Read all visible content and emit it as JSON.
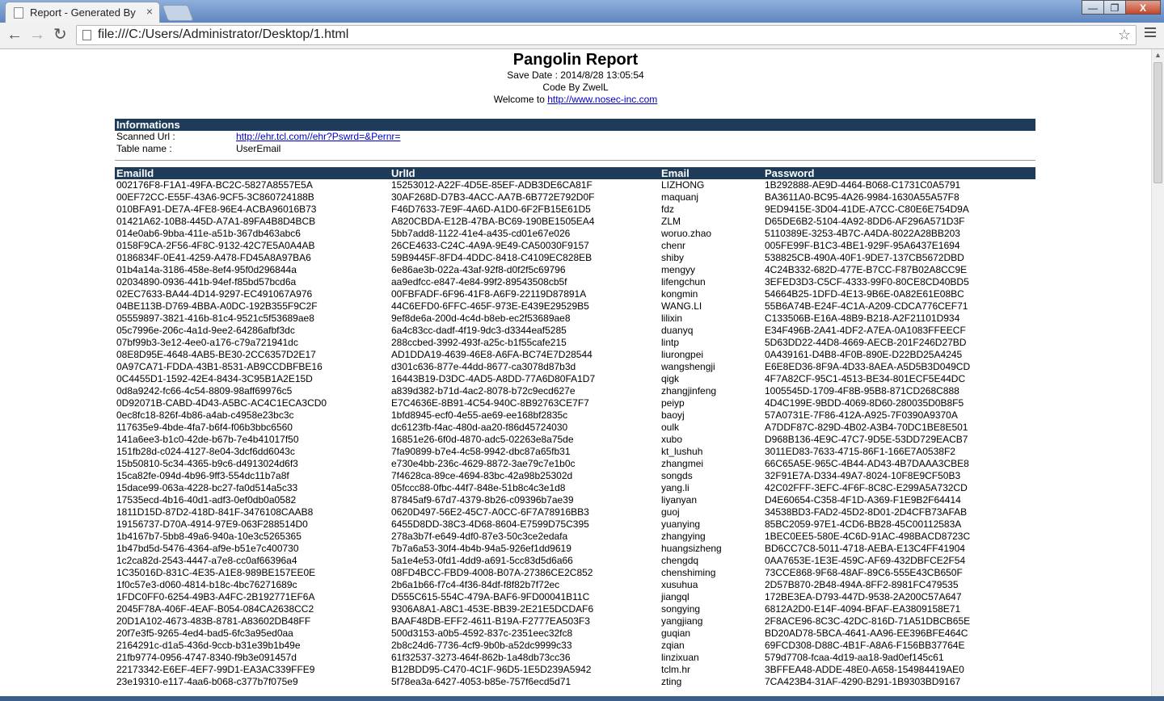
{
  "browser": {
    "tab_title": "Report - Generated By",
    "tab_close": "×",
    "url": "file:///C:/Users/Administrator/Desktop/1.html",
    "back": "←",
    "forward": "→",
    "reload": "↻",
    "star": "☆",
    "min": "—",
    "max": "❐",
    "close": "X"
  },
  "report": {
    "title": "Pangolin Report",
    "save_date": "Save Date : 2014/8/28 13:05:54",
    "code_by": "Code By ZwelL",
    "welcome_prefix": "Welcome to ",
    "welcome_link": "http://www.nosec-inc.com"
  },
  "informations": {
    "heading": "Informations",
    "scanned_url_label": "Scanned Url :",
    "scanned_url_value": "http://ehr.tcl.com//ehr?Pswrd=&Pernr=",
    "table_name_label": "Table name :",
    "table_name_value": "UserEmail"
  },
  "table": {
    "columns": [
      "EmailId",
      "UrlId",
      "Email",
      "Password"
    ],
    "rows": [
      [
        "002176F8-F1A1-49FA-BC2C-5827A8557E5A",
        "15253012-A22F-4D5E-85EF-ADB3DE6CA81F",
        "LIZHONG",
        "1B292888-AE9D-4464-B068-C1731C0A5791"
      ],
      [
        "00EF72CC-E55F-43A6-9CF5-3C860724188B",
        "30AF268D-D7B3-4ACC-AA7B-6B772E792D0F",
        "maquanj",
        "BA3611A0-BC95-4A26-9984-1630A55A57F8"
      ],
      [
        "010BFA91-DE7A-4FE8-96E4-ACBA96016B73",
        "F46D7633-7E9F-4A6D-A1D0-6F2FB15E61D5",
        "fdz",
        "9ED9415E-3D04-41DE-A7CC-C80E6E754D9A"
      ],
      [
        "01421A62-10B8-445D-A7A1-89FA4B8D4BCB",
        "A820CBDA-E12B-47BA-BC69-190BE1505EA4",
        "ZLM",
        "D65DE6B2-5104-4A92-8DD6-AF296A571D3F"
      ],
      [
        "014e0ab6-9bba-411e-a51b-367db463abc6",
        "5bb7add8-1122-41e4-a435-cd01e67e026",
        "woruo.zhao",
        "5110389E-3253-4B7C-A4DA-8022A28BB203"
      ],
      [
        "0158F9CA-2F56-4F8C-9132-42C7E5A0A4AB",
        "26CE4633-C24C-4A9A-9E49-CA50030F9157",
        "chenr",
        "005FE99F-B1C3-4BE1-929F-95A6437E1694"
      ],
      [
        "0186834F-0E41-4259-A478-FD45A8A97BA6",
        "59B9445F-8FD4-4DDC-8418-C4109EC828EB",
        "shiby",
        "538825CB-490A-40F1-9DE7-137CB5672DBD"
      ],
      [
        "01b4a14a-3186-458e-8ef4-95f0d296844a",
        "6e86ae3b-022a-43af-92f8-d0f2f5c69796",
        "mengyy",
        "4C24B332-682D-477E-B7CC-F87B02A8CC9E"
      ],
      [
        "02034890-0936-441b-94ef-f85bd57bcd6a",
        "aa9edfcc-e847-4e84-99f2-89543508cb5f",
        "lifengchun",
        "3EFED3D3-C5CF-4333-99F0-80CE8CD40BD5"
      ],
      [
        "02EC7633-BA44-4D14-9297-EC491067A976",
        "00FBFADF-6F96-41F8-A6F9-22119D87891A",
        "kongmin",
        "54664B25-1DFD-4E13-9B6E-0A82E61E08BC"
      ],
      [
        "04BE113B-D769-4BBA-A0DC-192B355F9C2F",
        "44C6EFD0-6FFC-465F-973E-E439E29529B5",
        "WANG.LI",
        "55B6A74B-E24F-4C1A-A209-CDCA776CEF71"
      ],
      [
        "05559897-3821-416b-81c4-9521c5f53689ae8",
        "9ef8de6a-200d-4c4d-b8eb-ec2f53689ae8",
        "lilixin",
        "C133506B-E16A-48B9-B218-A2F21101D934"
      ],
      [
        "05c7996e-206c-4a1d-9ee2-64286afbf3dc",
        "6a4c83cc-dadf-4f19-9dc3-d3344eaf5285",
        "duanyq",
        "E34F496B-2A41-4DF2-A7EA-0A1083FFEECF"
      ],
      [
        "07bf99b3-3e12-4ee0-a176-c79a721941dc",
        "288ccbed-3992-493f-a25c-b1f55cafe215",
        "lintp",
        "5D63DD22-44D8-4669-AECB-201F246D27BD"
      ],
      [
        "08E8D95E-4648-4AB5-BE30-2CC6357D2E17",
        "AD1DDA19-4639-46E8-A6FA-BC74E7D28544",
        "liurongpei",
        "0A439161-D4B8-4F0B-890E-D22BD25A4245"
      ],
      [
        "0A97CA71-FDDA-43B1-8531-AB9CCDBFBE16",
        "d301c636-877e-44dd-8677-ca3078d87b3d",
        "wangshengji",
        "E6E8ED36-8F9A-4D33-8AEA-A5D5B3D049CD"
      ],
      [
        "0C4455D1-1592-42E4-8434-3C95B1A2E15D",
        "16443B19-D3DC-4AD5-A8DD-77A6D80FA1D7",
        "qigk",
        "4F7A82CF-95C1-4513-BE34-801ECF5E44DC"
      ],
      [
        "0d8a9242-fc66-4c54-8809-98aff69976c5",
        "a839d382-b71d-4ac2-8078-b72c9ecd627e",
        "zhangjinfeng",
        "1005545D-1709-4F8B-95B8-871CD268C888"
      ],
      [
        "0D92071B-CABD-4D43-A5BC-AC4C1ECA3CD0",
        "E7C4636E-8B91-4C54-940C-8B92763CE7F7",
        "peiyp",
        "4D4C199E-9BDD-4069-8D60-280035D0B8F5"
      ],
      [
        "0ec8fc18-826f-4b86-a4ab-c4958e23bc3c",
        "1bfd8945-ecf0-4e55-ae69-ee168bf2835c",
        "baoyj",
        "57A0731E-7F86-412A-A925-7F0390A9370A"
      ],
      [
        "117635e9-4bde-4fa7-b6f4-f06b3bbc6560",
        "dc6123fb-f4ac-480d-aa20-f86d45724030",
        "oulk",
        "A7DDF87C-829D-4B02-A3B4-70DC1BE8E501"
      ],
      [
        "141a6ee3-b1c0-42de-b67b-7e4b41017f50",
        "16851e26-6f0d-4870-adc5-02263e8a75de",
        "xubo",
        "D968B136-4E9C-47C7-9D5E-53DD729EACB7"
      ],
      [
        "151fb28d-c024-4127-8e04-3dcf6dd6043c",
        "7fa90899-b7e4-4c58-9942-dbc87a65fb31",
        "kt_lushuh",
        "3011ED83-7633-4715-86F1-166E7A0538F2"
      ],
      [
        "15b50810-5c34-4365-b9c6-d4913024d6f3",
        "e730e4bb-236c-4629-8872-3ae79c7e1b0c",
        "zhangmei",
        "66C65A5E-965C-4B44-AD43-4B7DAAA3CBE8"
      ],
      [
        "15ca82fe-094d-4b96-9ff3-554dc11b7a8f",
        "7f4628ca-89ce-4694-83bc-42a98b25302d",
        "songds",
        "32F91E7A-D334-49A7-8024-10F8E9CF50B3"
      ],
      [
        "15dace99-063a-4228-bc27-fa0d514a5c33",
        "05fccc88-0fbc-44f7-848e-51b8c4c3e1d8",
        "yang.li",
        "42C02FFF-3EFC-4F6F-8C8C-E299A5A732CD"
      ],
      [
        "17535ecd-4b16-40d1-adf3-0ef0db0a0582",
        "87845af9-67d7-4379-8b26-c09396b7ae39",
        "liyanyan",
        "D4E60654-C358-4F1D-A369-F1E9B2F64414"
      ],
      [
        "1811D15D-87D2-418D-841F-3476108CAAB8",
        "0620D497-56E2-45C7-A0CC-6F7A78916BB3",
        "guoj",
        "34538BD3-FAD2-45D2-8D01-2D4CFB73AFAB"
      ],
      [
        "19156737-D70A-4914-97E9-063F288514D0",
        "6455D8DD-38C3-4D68-8604-E7599D75C395",
        "yuanying",
        "85BC2059-97E1-4CD6-BB28-45C00112583A"
      ],
      [
        "1b4167b7-5bb8-49a6-940a-10e3c5265365",
        "278a3b7f-e649-4df0-87e3-50c3ce2edafa",
        "zhangying",
        "1BEC0EE5-580E-4C6D-91AC-498BACD8723C"
      ],
      [
        "1b47bd5d-5476-4364-af9e-b51e7c400730",
        "7b7a6a53-30f4-4b4b-94a5-926ef1dd9619",
        "huangsizheng",
        "BD6CC7C8-5011-4718-AEBA-E13C4FF41904"
      ],
      [
        "1c2ca82d-2543-4447-a7e8-cc0af66396a4",
        "5a1e4e53-0fd1-4dd9-a691-5cc83d5d6a66",
        "chengdq",
        "0AA7653E-1E3E-459C-AF69-432DBFCE2F54"
      ],
      [
        "1C35016D-831C-4E35-A1E8-989BE157EE0E",
        "08FD4BCC-FBD9-4008-B07A-27386CE2C852",
        "chenshiming",
        "73CCE868-9F68-48AF-89C6-555E43CB650F"
      ],
      [
        "1f0c57e3-d060-4814-b18c-4bc76271689c",
        "2b6a1b66-f7c4-4f36-84df-f8f82b7f72ec",
        "xusuhua",
        "2D57B870-2B48-494A-8FF2-8981FC479535"
      ],
      [
        "1FDC0FF0-6254-49B3-A4FC-2B192771EF6A",
        "D555C615-554C-479A-BAF6-9FD00041B11C",
        "jiangql",
        "172BE3EA-D793-447D-9538-2A200C57A647"
      ],
      [
        "2045F78A-406F-4EAF-B054-084CA2638CC2",
        "9306A8A1-A8C1-453E-BB39-2E21E5DCDAF6",
        "songying",
        "6812A2D0-E14F-4094-BFAF-EA3809158E71"
      ],
      [
        "20D1A102-4673-483B-8781-A83602DB48FF",
        "BAAF48DB-EFF2-4611-B19A-F2777EA503F3",
        "yangjiang",
        "2F8ACE96-8C3C-42DC-816D-71A51DBCB65E"
      ],
      [
        "20f7e3f5-9265-4ed4-bad5-6fc3a95ed0aa",
        "500d3153-a0b5-4592-837c-2351eec32fc8",
        "guqian",
        "BD20AD78-5BCA-4641-AA96-EE396BFE464C"
      ],
      [
        "2164291c-d1a5-436d-9ccb-b31e39b1b49e",
        "2b8c24d6-7736-4cf9-9b0b-a52dc9999c33",
        "zqian",
        "69FCD308-D88C-4B1F-A8A6-F156BB37764E"
      ],
      [
        "21fb9774-0956-4747-8340-f9b3e091457d",
        "61f32537-3273-464f-862b-1a48db73cc36",
        "linzixuan",
        "579d7708-fcaa-4d19-aa18-9ad0ef145c61"
      ],
      [
        "22173342-E6EF-4EF7-99D1-EA3AC339FFE9",
        "B12BDD95-C470-4C1F-96D5-1E5D239A5942",
        "tclm.hr",
        "3BFFEA48-ADDE-48E0-A658-154984419AE0"
      ],
      [
        "23e19310-e117-4aa6-b068-c377b7f075e9",
        "5f78ea3a-6427-4053-b85e-757f6ecd5d71",
        "zting",
        "7CA423B4-31AF-4290-B291-1B9303BD9167"
      ]
    ]
  }
}
